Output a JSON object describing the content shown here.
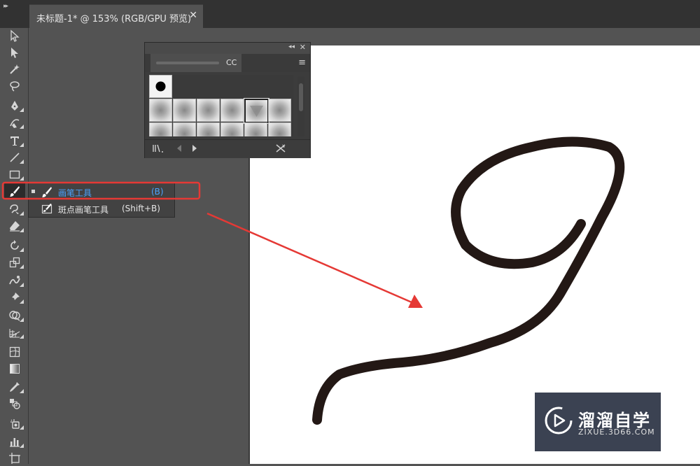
{
  "document_tab": {
    "title": "未标题-1* @ 153% (RGB/GPU 预览)",
    "close_glyph": "✕"
  },
  "brushes_panel": {
    "collapse_glyph": "◂◂",
    "close_glyph": "✕",
    "tab_suffix": "CC",
    "menu_glyph": "≡"
  },
  "tool_flyout": {
    "items": [
      {
        "label": "画笔工具",
        "shortcut": "(B)",
        "selected": true
      },
      {
        "label": "斑点画笔工具",
        "shortcut": "(Shift+B)",
        "selected": false
      }
    ]
  },
  "watermark": {
    "name": "溜溜自学",
    "url": "ZIXUE.3D66.COM"
  },
  "colors": {
    "annotation_red": "#e53935",
    "selected_text_blue": "#4aa3ff",
    "stroke": "#231815"
  }
}
